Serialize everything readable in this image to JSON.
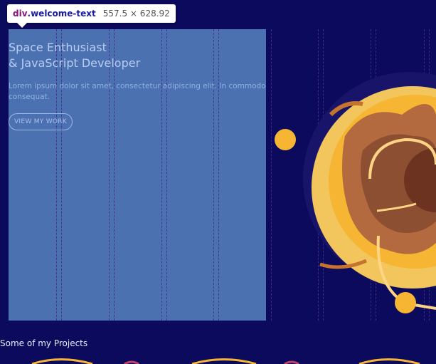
{
  "devtools_tooltip": {
    "tag": "div",
    "class_name": ".welcome-text",
    "size": "557.5 × 628.92"
  },
  "hero": {
    "title_line1": "Space Enthusiast",
    "title_line2": "& JavaScript Developer",
    "paragraph": "Lorem ipsum dolor sit amet, consectetur adipiscing elit. In commodo consequat.",
    "cta_label": "VIEW MY WORK"
  },
  "projects_heading": "Some of my Projects",
  "colors": {
    "background": "#0c0a5c",
    "overlay": "#5077b4",
    "planet": "#f6b532",
    "planet_core": "#7a3a25"
  },
  "icons": [
    "planet-illustration",
    "moon-orb"
  ]
}
